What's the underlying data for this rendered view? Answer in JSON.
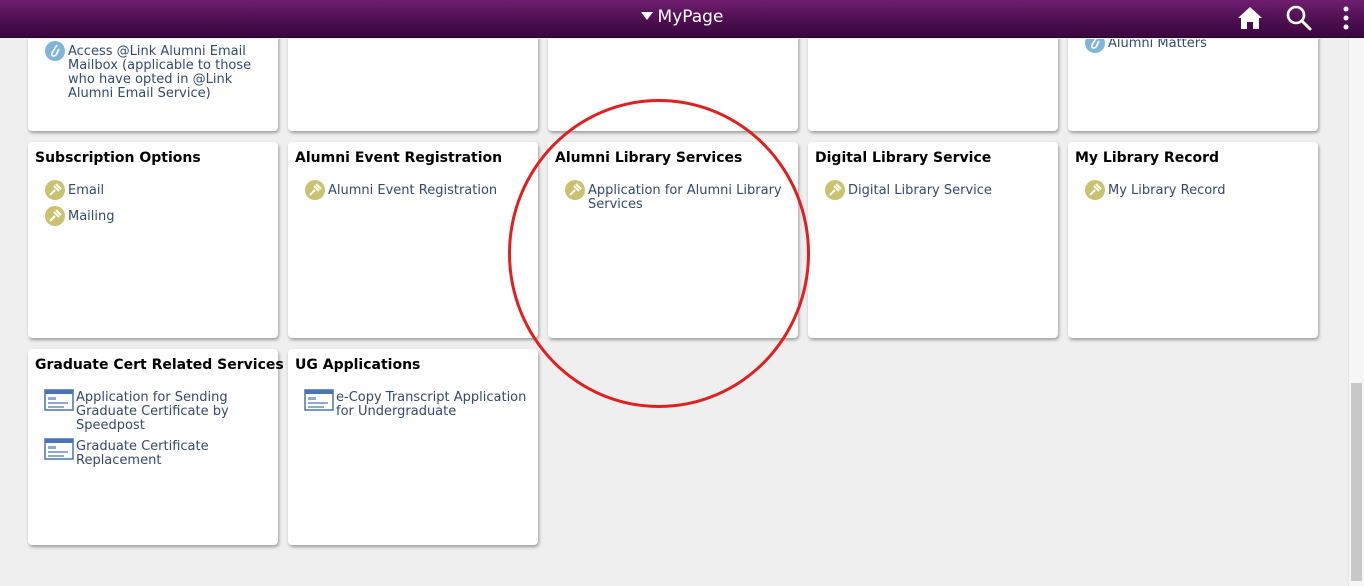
{
  "header": {
    "title": "MyPage",
    "icons": [
      "home-icon",
      "search-icon",
      "more-vert-icon"
    ]
  },
  "tiles_top": [
    {
      "items": [
        {
          "label": "Access @Link Alumni Email Mailbox (applicable to those who have opted in @Link Alumni Email Service)",
          "icon": "link-icon"
        }
      ]
    },
    {
      "items": []
    },
    {
      "items": []
    },
    {
      "items": []
    },
    {
      "items": [
        {
          "label": "Alumni Matters",
          "icon": "link-icon"
        }
      ]
    }
  ],
  "tiles_row2": [
    {
      "title": "Subscription Options",
      "items": [
        {
          "label": "Email",
          "icon": "pin-icon"
        },
        {
          "label": "Mailing",
          "icon": "pin-icon"
        }
      ]
    },
    {
      "title": "Alumni Event Registration",
      "items": [
        {
          "label": "Alumni Event Registration",
          "icon": "pin-icon"
        }
      ]
    },
    {
      "title": "Alumni Library Services",
      "items": [
        {
          "label": "Application for Alumni Library Services",
          "icon": "pin-icon"
        }
      ]
    },
    {
      "title": "Digital Library Service",
      "items": [
        {
          "label": "Digital Library Service",
          "icon": "pin-icon"
        }
      ]
    },
    {
      "title": "My Library Record",
      "items": [
        {
          "label": "My Library Record",
          "icon": "pin-icon"
        }
      ]
    }
  ],
  "tiles_row3": [
    {
      "title": "Graduate Cert Related Services",
      "items": [
        {
          "label": "Application for Sending Graduate Certificate by Speedpost",
          "icon": "form-icon"
        },
        {
          "label": "Graduate Certificate Replacement",
          "icon": "form-icon"
        }
      ]
    },
    {
      "title": "UG Applications",
      "items": [
        {
          "label": "e-Copy Transcript Application for Undergraduate",
          "icon": "form-icon"
        }
      ]
    }
  ],
  "colors": {
    "banner": "#4e0f50",
    "link_text": "#334a6a",
    "annotation": "#e02020"
  }
}
